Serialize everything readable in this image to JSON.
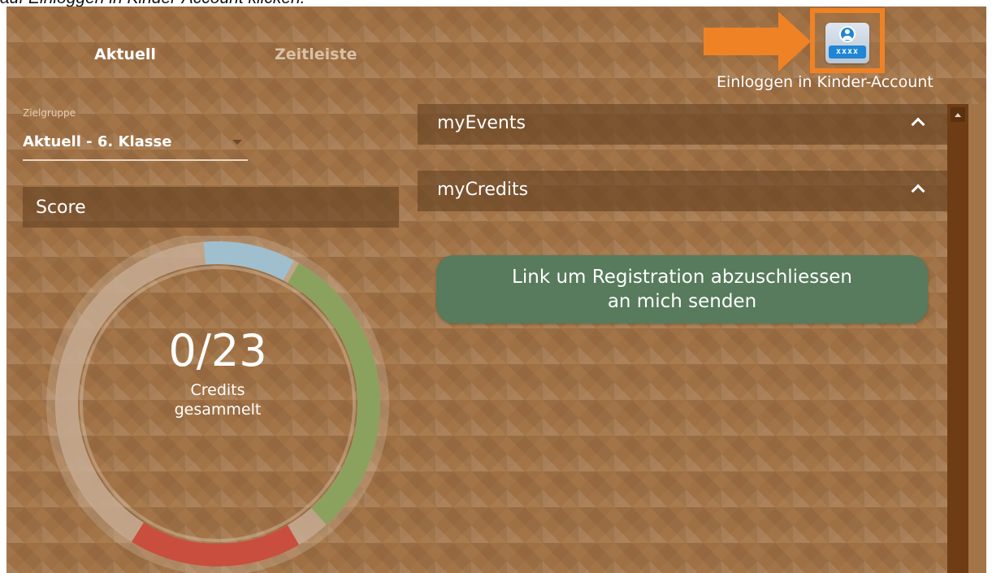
{
  "caption": "auf Einloggen in Kinder-Account klicken.",
  "tabs": [
    {
      "label": "Aktuell",
      "active": true
    },
    {
      "label": "Zeitleiste",
      "active": false
    }
  ],
  "kid_login": {
    "icon": "kid-account-icon",
    "password_mask": "xxxx",
    "label": "Einloggen in Kinder-Account"
  },
  "zielgruppe": {
    "label": "Zielgruppe",
    "value": "Aktuell - 6. Klasse"
  },
  "score": {
    "header": "Score",
    "value": "0/23",
    "caption_line1": "Credits",
    "caption_line2": "gesammelt"
  },
  "panels": [
    {
      "title": "myEvents"
    },
    {
      "title": "myCredits"
    }
  ],
  "register_button": {
    "line1": "Link um Registration abzuschliessen",
    "line2": "an mich senden"
  },
  "colors": {
    "background": "#a37448",
    "highlight": "#f08226",
    "button": "#577b5c",
    "ring_blue": "#9fbfce",
    "ring_green": "#8aa25d",
    "ring_red": "#c94e3e",
    "ring_track": "#c7ad94"
  }
}
